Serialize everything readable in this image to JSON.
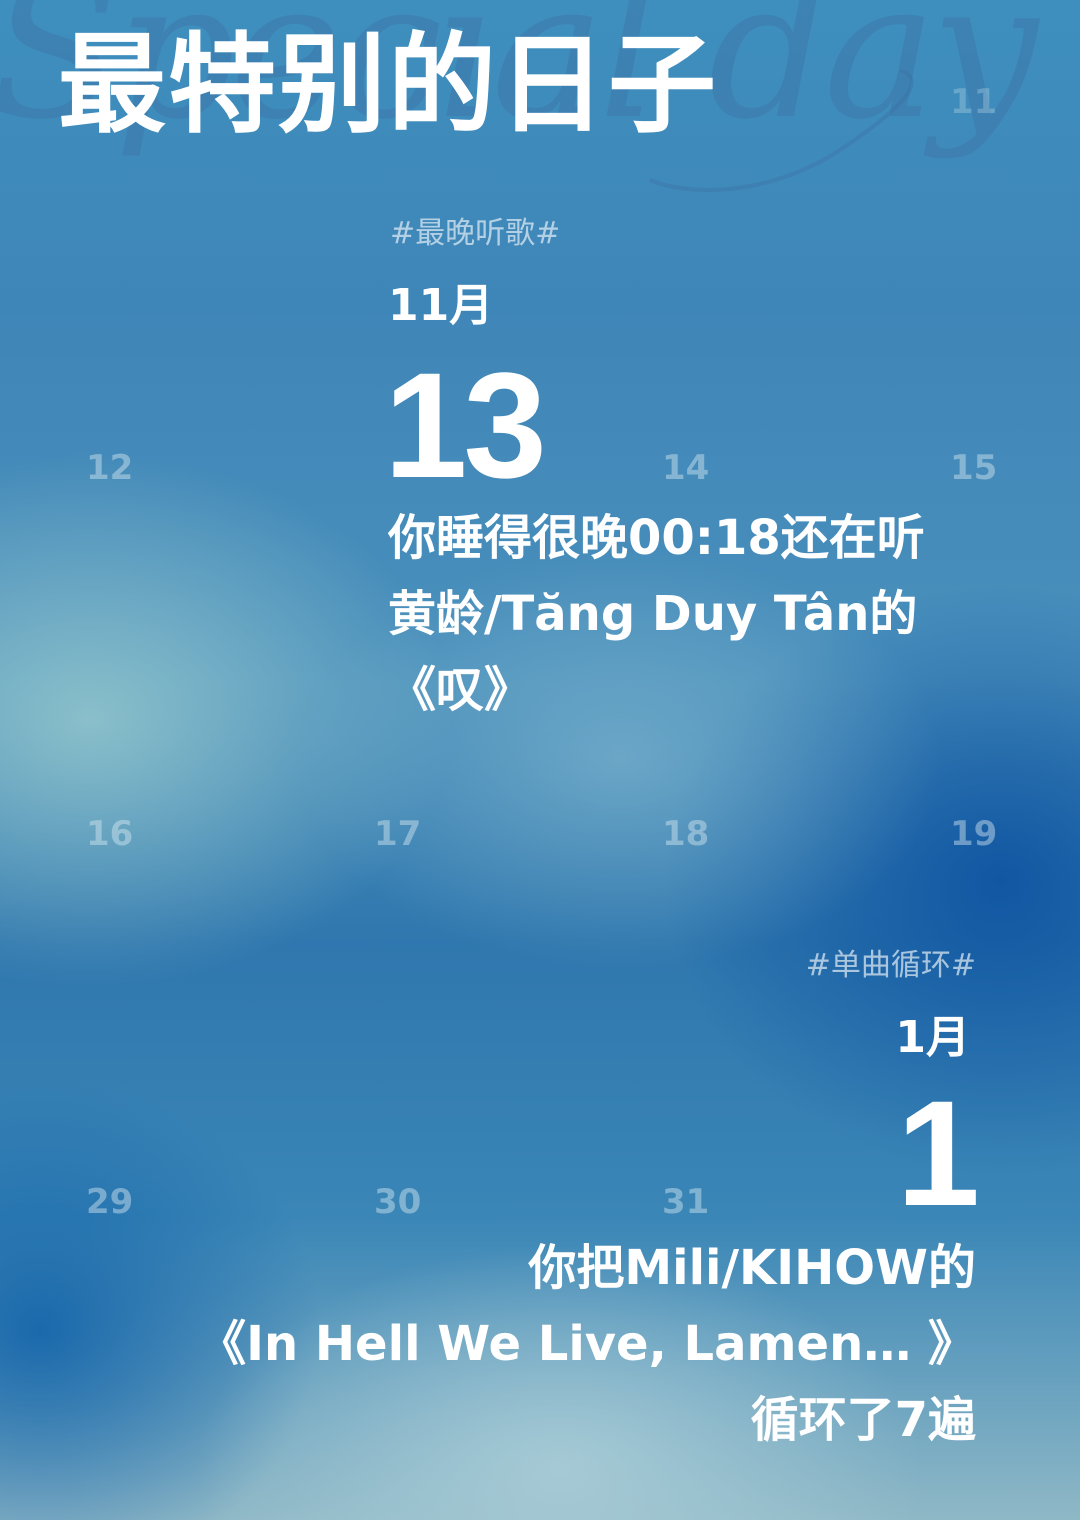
{
  "page": {
    "title": "最特别的日子"
  },
  "calendar_numbers": {
    "n11": "11",
    "n12": "12",
    "n14": "14",
    "n15": "15",
    "n16": "16",
    "n17": "17",
    "n18": "18",
    "n19": "19",
    "n29": "29",
    "n30": "30",
    "n31": "31"
  },
  "cards": [
    {
      "tag": "#最晚听歌#",
      "month": "11月",
      "day": "13",
      "lines": [
        "你睡得很晚00:18还在听",
        "黄龄/Tăng Duy Tân的",
        "《叹》"
      ]
    },
    {
      "tag": "#单曲循环#",
      "month": "1月",
      "day": "1",
      "lines": [
        "你把Mili/KIHOW的",
        "《In Hell We Live, Lamen… 》",
        "循环了7遍"
      ]
    }
  ],
  "colors": {
    "background_top": "#3e8fbe",
    "background_deep": "#0a50a0",
    "background_light": "#aacdd7",
    "text": "#ffffff"
  }
}
